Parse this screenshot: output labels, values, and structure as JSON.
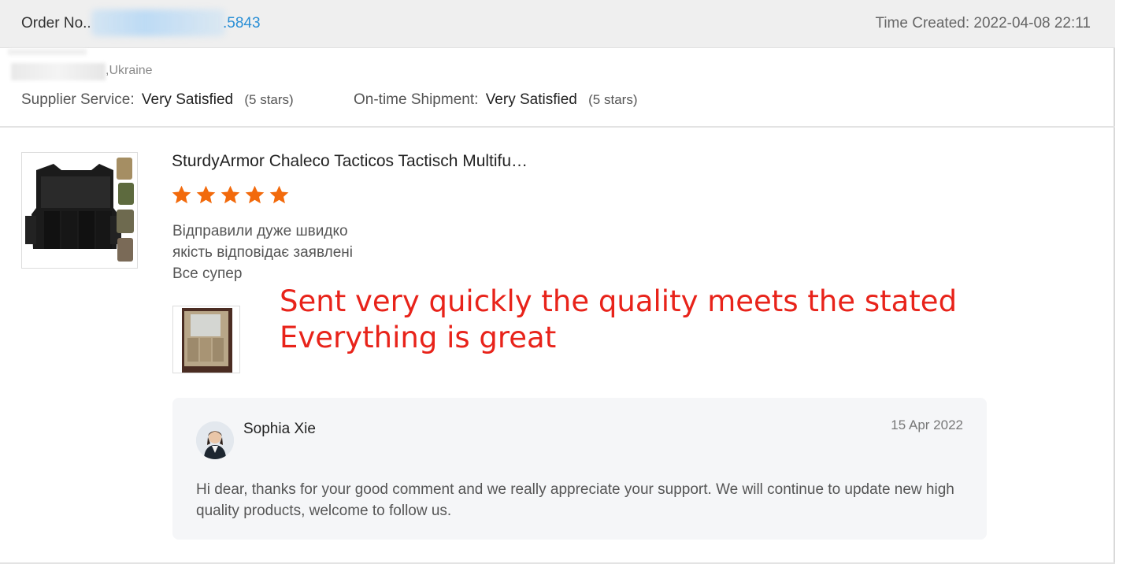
{
  "order": {
    "label": "Order No..",
    "number_suffix": ".5843",
    "time_created": "Time Created: 2022-04-08 22:11"
  },
  "buyer": {
    "location": ",Ukraine"
  },
  "ratings": {
    "supplier_label": "Supplier Service:",
    "supplier_value": "Very Satisfied",
    "supplier_stars": "(5 stars)",
    "shipment_label": "On-time Shipment:",
    "shipment_value": "Very Satisfied",
    "shipment_stars": "(5 stars)"
  },
  "product": {
    "title": "SturdyArmor Chaleco Tacticos Tactisch Multifu…",
    "rating": 5,
    "star_color": "#f26a0c",
    "review_lines": [
      "Відправили дуже швидко",
      "якість відповідає заявлені",
      "Все супер"
    ],
    "thumbnail_icon": "tactical-vest-image",
    "photo_icon": "review-photo-image"
  },
  "translation": {
    "line1": "Sent very quickly the quality meets the stated",
    "line2": "Everything is great",
    "color": "#e8231a"
  },
  "reply": {
    "name": "Sophia Xie",
    "date": "15 Apr 2022",
    "text": "Hi dear, thanks for your good comment and we really appreciate your support. We will continue to update new high quality products, welcome to follow us."
  }
}
